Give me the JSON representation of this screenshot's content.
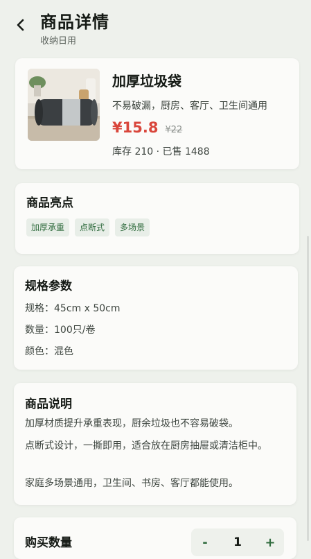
{
  "header": {
    "title": "商品详情",
    "subtitle": "收纳日用"
  },
  "product": {
    "name": "加厚垃圾袋",
    "description": "不易破漏，厨房、客厅、卫生间通用",
    "price": "¥15.8",
    "original_price": "¥22",
    "stock_sales": "库存 210 · 已售 1488"
  },
  "highlights": {
    "title": "商品亮点",
    "tags": [
      "加厚承重",
      "点断式",
      "多场景"
    ]
  },
  "specs": {
    "title": "规格参数",
    "lines": [
      "规格：45cm x 50cm",
      "数量：100只/卷",
      "颜色：混色"
    ]
  },
  "description": {
    "title": "商品说明",
    "paragraphs": [
      "加厚材质提升承重表现，厨余垃圾也不容易破袋。",
      "点断式设计，一撕即用，适合放在厨房抽屉或清洁柜中。",
      "家庭多场景通用，卫生间、书房、客厅都能使用。"
    ]
  },
  "quantity": {
    "title": "购买数量",
    "minus": "-",
    "value": "1",
    "plus": "+"
  },
  "colors": {
    "accent": "#2f6b3d",
    "price": "#d9463b",
    "background": "#eef1ec",
    "card": "#fbfbf9"
  }
}
